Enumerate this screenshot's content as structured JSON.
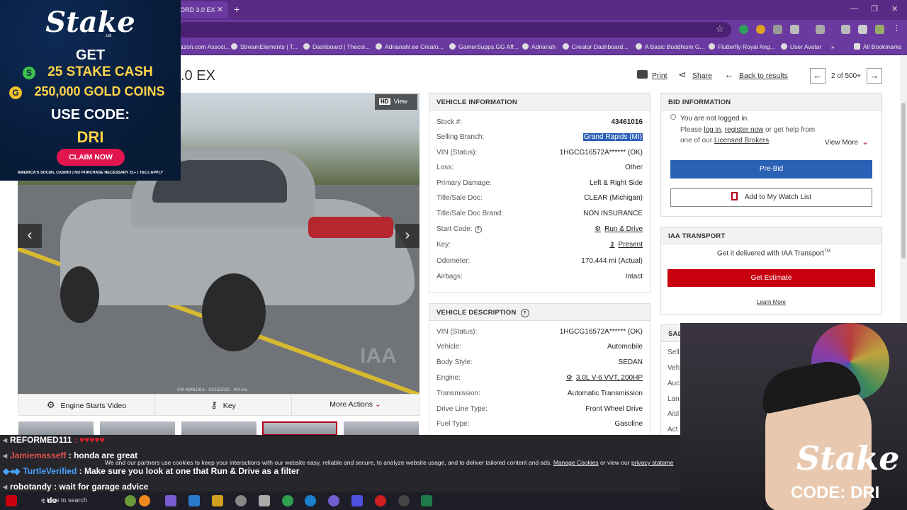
{
  "browser": {
    "active_tab_title": "ORD 3.0 EX",
    "bookmarks": [
      "azon.com Associ...",
      "StreamElements | T...",
      "Dashboard | Thecol...",
      "Adrianahl.ee Creato...",
      "GamerSupps.GG Aff...",
      "Adrianah",
      "Creator Dashboard...",
      "A Basic Buddhism G...",
      "Flutterfly Royal Ang...",
      "User Avatar"
    ],
    "more_bookmarks": "»",
    "all_bookmarks": "All Bookmarks"
  },
  "listing": {
    "title": ".0 EX",
    "print": "Print",
    "share": "Share",
    "back": "Back to results",
    "pager": "2 of 500+",
    "photo": {
      "hd_view": "View",
      "hd": "HD",
      "caption": "000-43461016 - 10/15/2025 - IAA Inc.",
      "watermark": "IAA"
    },
    "actions": [
      "Engine Starts Video",
      "Key",
      "More Actions"
    ]
  },
  "vehicle_information": {
    "heading": "VEHICLE INFORMATION",
    "rows": [
      {
        "label": "Stock #:",
        "value": "43461016"
      },
      {
        "label": "Selling Branch:",
        "value": "Grand Rapids (MI)"
      },
      {
        "label": "VIN (Status):",
        "value": "1HGCG16572A****** (OK)"
      },
      {
        "label": "Loss:",
        "value": "Other"
      },
      {
        "label": "Primary Damage:",
        "value": "Left & Right Side"
      },
      {
        "label": "Title/Sale Doc:",
        "value": "CLEAR (Michigan)"
      },
      {
        "label": "Title/Sale Doc Brand:",
        "value": "NON INSURANCE"
      },
      {
        "label": "Start Code:",
        "value": "Run & Drive"
      },
      {
        "label": "Key:",
        "value": "Present"
      },
      {
        "label": "Odometer:",
        "value": "170,444 mi (Actual)"
      },
      {
        "label": "Airbags:",
        "value": "Intact"
      }
    ]
  },
  "vehicle_description": {
    "heading": "VEHICLE DESCRIPTION",
    "rows": [
      {
        "label": "VIN (Status):",
        "value": "1HGCG16572A****** (OK)"
      },
      {
        "label": "Vehicle:",
        "value": "Automobile"
      },
      {
        "label": "Body Style:",
        "value": "SEDAN"
      },
      {
        "label": "Engine:",
        "value": "3.0L V-6 VVT, 200HP"
      },
      {
        "label": "Transmission:",
        "value": "Automatic Transmission"
      },
      {
        "label": "Drive Line Type:",
        "value": "Front Wheel Drive"
      },
      {
        "label": "Fuel Type:",
        "value": "Gasoline"
      }
    ]
  },
  "bid_information": {
    "heading": "BID INFORMATION",
    "not_logged_in": "You are not logged in.",
    "please": "Please",
    "log_in": "log in",
    "register": "register now",
    "or_help": "or get help from one of our",
    "brokers": "Licensed Brokers",
    "view_more": "View More",
    "prebid": "Pre-Bid",
    "watch_list": "Add to My Watch List"
  },
  "transport": {
    "heading": "IAA TRANSPORT",
    "text": "Get it delivered with IAA Transport",
    "tm": "TM",
    "estimate": "Get Estimate",
    "learn_more": "Learn More"
  },
  "sale_panel": {
    "heading": "SAL",
    "labels": [
      "Sell",
      "Veh",
      "Auc",
      "Lan",
      "Aisl",
      "Act"
    ]
  },
  "ad": {
    "logo": "Stake",
    "us": ".us",
    "get": "GET",
    "cash": "25 STAKE CASH",
    "coins": "250,000 GOLD COINS",
    "use_code": "USE CODE:",
    "code": "DRI",
    "claim": "CLAIM NOW",
    "footer": "AMERICA'S SOCIAL CASINO  |  NO PURCHASE NECESSARY     21+ | T&Cs APPLY",
    "coin_s": "S",
    "coin_g": "G"
  },
  "chat": [
    {
      "user": "REFORMED111",
      "text": ": ♥♥♥♥♥"
    },
    {
      "user": "Jamiemasseff",
      "text": ": honda are great"
    },
    {
      "user": "TurtleVerified",
      "text": ": Make sure you look at one that Run & Drive as a filter"
    },
    {
      "user": "robotandy",
      "text": ": wait for garage advice"
    }
  ],
  "cookie_banner": {
    "text": "We and our partners use cookies to keep your interactions with our website easy, reliable and secure, to analyze website usage, and to deliver tailored content and ads.",
    "manage": "Manage Cookies",
    "or_view": "or view our",
    "privacy": "privacy stateme"
  },
  "taskbar": {
    "search_placeholder": "e here to search",
    "chat_partial": ": do"
  },
  "webcam": {
    "brand": "Stake",
    "code": "CODE: DRI"
  }
}
